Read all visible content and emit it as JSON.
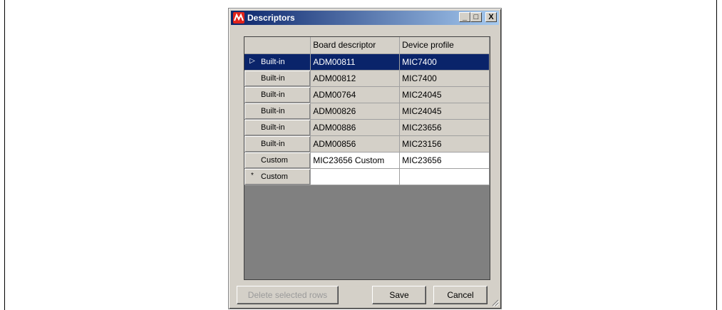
{
  "window": {
    "title": "Descriptors",
    "title_colors": [
      "#0a246a",
      "#a6caf0"
    ],
    "controls": {
      "minimize": "_",
      "maximize": "□",
      "close": "X"
    }
  },
  "grid": {
    "columns": [
      "Board descriptor",
      "Device profile"
    ],
    "rows": [
      {
        "type": "Built-in",
        "board": "ADM00811",
        "device": "MIC7400",
        "marker": "▷",
        "selected": true
      },
      {
        "type": "Built-in",
        "board": "ADM00812",
        "device": "MIC7400",
        "marker": ""
      },
      {
        "type": "Built-in",
        "board": "ADM00764",
        "device": "MIC24045",
        "marker": ""
      },
      {
        "type": "Built-in",
        "board": "ADM00826",
        "device": "MIC24045",
        "marker": ""
      },
      {
        "type": "Built-in",
        "board": "ADM00886",
        "device": "MIC23656",
        "marker": ""
      },
      {
        "type": "Built-in",
        "board": "ADM00856",
        "device": "MIC23156",
        "marker": ""
      },
      {
        "type": "Custom",
        "board": "MIC23656 Custom",
        "device": "MIC23656",
        "marker": ""
      },
      {
        "type": "Custom",
        "board": "",
        "device": "",
        "marker": "*"
      }
    ]
  },
  "buttons": {
    "delete_label": "Delete selected rows",
    "save_label": "Save",
    "cancel_label": "Cancel"
  },
  "colors": {
    "selection": "#0a246a",
    "window_face": "#d4d0c8",
    "grid_background": "#808080"
  }
}
